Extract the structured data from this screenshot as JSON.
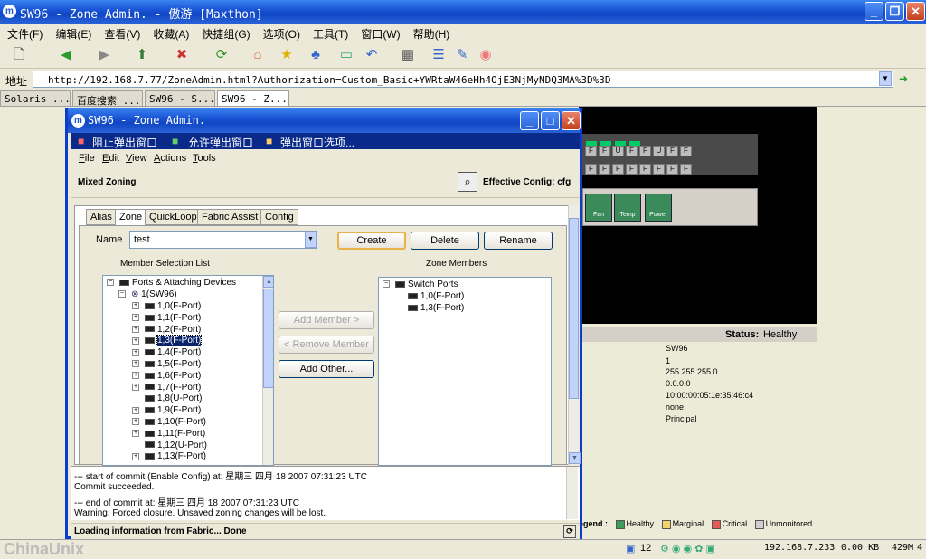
{
  "browser": {
    "title": "SW96 - Zone Admin. - 傲游 [Maxthon]",
    "menu": [
      "文件(F)",
      "编辑(E)",
      "查看(V)",
      "收藏(A)",
      "快捷组(G)",
      "选项(O)",
      "工具(T)",
      "窗口(W)",
      "帮助(H)"
    ],
    "address_label": "地址",
    "address": "http://192.168.7.77/ZoneAdmin.html?Authorization=Custom_Basic+YWRtaW46eHh4OjE3NjMyNDQ3MA%3D%3D",
    "tabs": [
      "Solaris ...",
      "百度搜索_...",
      "SW96 - S...",
      "SW96 - Z..."
    ],
    "status": {
      "count": "12",
      "ip": "192.168.7.233",
      "size": "0.00 KB",
      "mem": "429M",
      "page": "4"
    }
  },
  "background": {
    "ports_row1": [
      "F",
      "F",
      "U",
      "F",
      "F",
      "U",
      "F",
      "F"
    ],
    "ports_row2": [
      "F",
      "F",
      "F",
      "F",
      "F",
      "F",
      "F",
      "F"
    ],
    "icons": [
      "Fan",
      "Temp",
      "Power"
    ],
    "status_label": "Status:",
    "status_value": "Healthy",
    "info": [
      "SW96",
      "1",
      "255.255.255.0",
      "0.0.0.0",
      "10:00:00:05:1e:35:46:c4",
      "none",
      "Principal"
    ],
    "legend_label": "egend :",
    "legend": [
      {
        "label": "Healthy",
        "color": "#3c9a5a"
      },
      {
        "label": "Marginal",
        "color": "#f3d36a"
      },
      {
        "label": "Critical",
        "color": "#e85a5a"
      },
      {
        "label": "Unmonitored",
        "color": "#cfcfcf"
      }
    ],
    "watermark": "ChinaUnix"
  },
  "popup": {
    "title": "SW96 - Zone Admin.",
    "popup_bar": [
      "阻止弹出窗口",
      "允许弹出窗口",
      "弹出窗口选项..."
    ],
    "menu": [
      "File",
      "Edit",
      "View",
      "Actions",
      "Tools"
    ],
    "mode": "Mixed Zoning",
    "effective_config": "Effective Config: cfg",
    "tabs": [
      "Alias",
      "Zone",
      "QuickLoop",
      "Fabric Assist",
      "Config"
    ],
    "name_label": "Name",
    "name_value": "test",
    "buttons": {
      "create": "Create",
      "delete": "Delete",
      "rename": "Rename",
      "add_member": "Add Member >",
      "remove_member": "< Remove Member",
      "add_other": "Add Other..."
    },
    "member_list_title": "Member Selection List",
    "zone_members_title": "Zone Members",
    "tree_root": "Ports & Attaching Devices",
    "tree_switch": "1(SW96)",
    "ports": [
      "1,0(F-Port)",
      "1,1(F-Port)",
      "1,2(F-Port)",
      "1,3(F-Port)",
      "1,4(F-Port)",
      "1,5(F-Port)",
      "1,6(F-Port)",
      "1,7(F-Port)",
      "1,8(U-Port)",
      "1,9(F-Port)",
      "1,10(F-Port)",
      "1,11(F-Port)",
      "1,12(U-Port)",
      "1,13(F-Port)"
    ],
    "selected_port_index": 3,
    "zone_root": "Switch Ports",
    "zone_ports": [
      "1,0(F-Port)",
      "1,3(F-Port)"
    ],
    "log": [
      "--- start of commit (Enable Config) at: 星期三 四月 18 2007 07:31:23 UTC",
      "Commit succeeded.",
      "--- end of commit at: 星期三 四月 18 2007 07:31:23 UTC",
      "Warning: Forced closure. Unsaved zoning changes will be lost."
    ],
    "status": "Loading information from Fabric... Done"
  }
}
